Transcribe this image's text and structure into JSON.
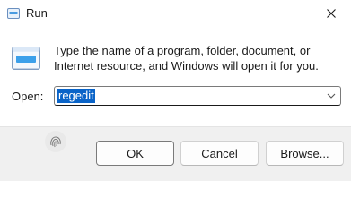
{
  "window": {
    "title": "Run"
  },
  "dialog": {
    "description": "Type the name of a program, folder, document, or Internet resource, and Windows will open it for you.",
    "open_label": "Open:",
    "open_value": "regedit"
  },
  "buttons": {
    "ok": "OK",
    "cancel": "Cancel",
    "browse": "Browse..."
  },
  "icons": {
    "app": "run-icon",
    "close": "close-icon",
    "dropdown": "chevron-down-icon",
    "shield": "fingerprint-icon"
  },
  "colors": {
    "selection": "#0a64c8",
    "footer": "#f0f0f0"
  }
}
